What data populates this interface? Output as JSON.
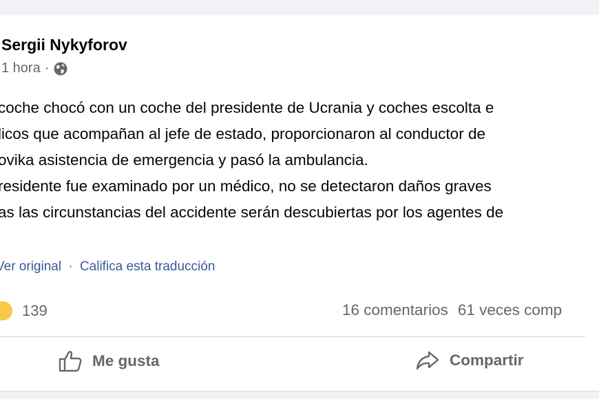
{
  "post": {
    "author": "Sergii Nykyforov",
    "time": "1 hora",
    "separator": "·",
    "privacy_icon": "globe-icon",
    "lines": [
      "coche chocó con un coche del presidente de Ucrania y coches escolta e",
      "licos que acompañan al jefe de estado, proporcionaron al conductor de",
      "ovika asistencia de emergencia y pasó la ambulancia.",
      "resident​e fue examinado por un médico, no se detectaron daños graves",
      "as las circunstancias del accidente serán descubiertas por los agentes de"
    ]
  },
  "translation": {
    "see_original": "Ver original",
    "separator": "·",
    "rate": "Califica esta traducción"
  },
  "reactions": {
    "icon": "sad-tear-emoji-icon",
    "count": "139"
  },
  "stats": {
    "comments": "16 comentarios",
    "shares": "61 veces comp"
  },
  "actions": {
    "like_label": "Me gusta",
    "share_label": "Compartir"
  },
  "colors": {
    "link": "#385898",
    "secondary_text": "#65676b",
    "background": "#f0f2f5"
  }
}
